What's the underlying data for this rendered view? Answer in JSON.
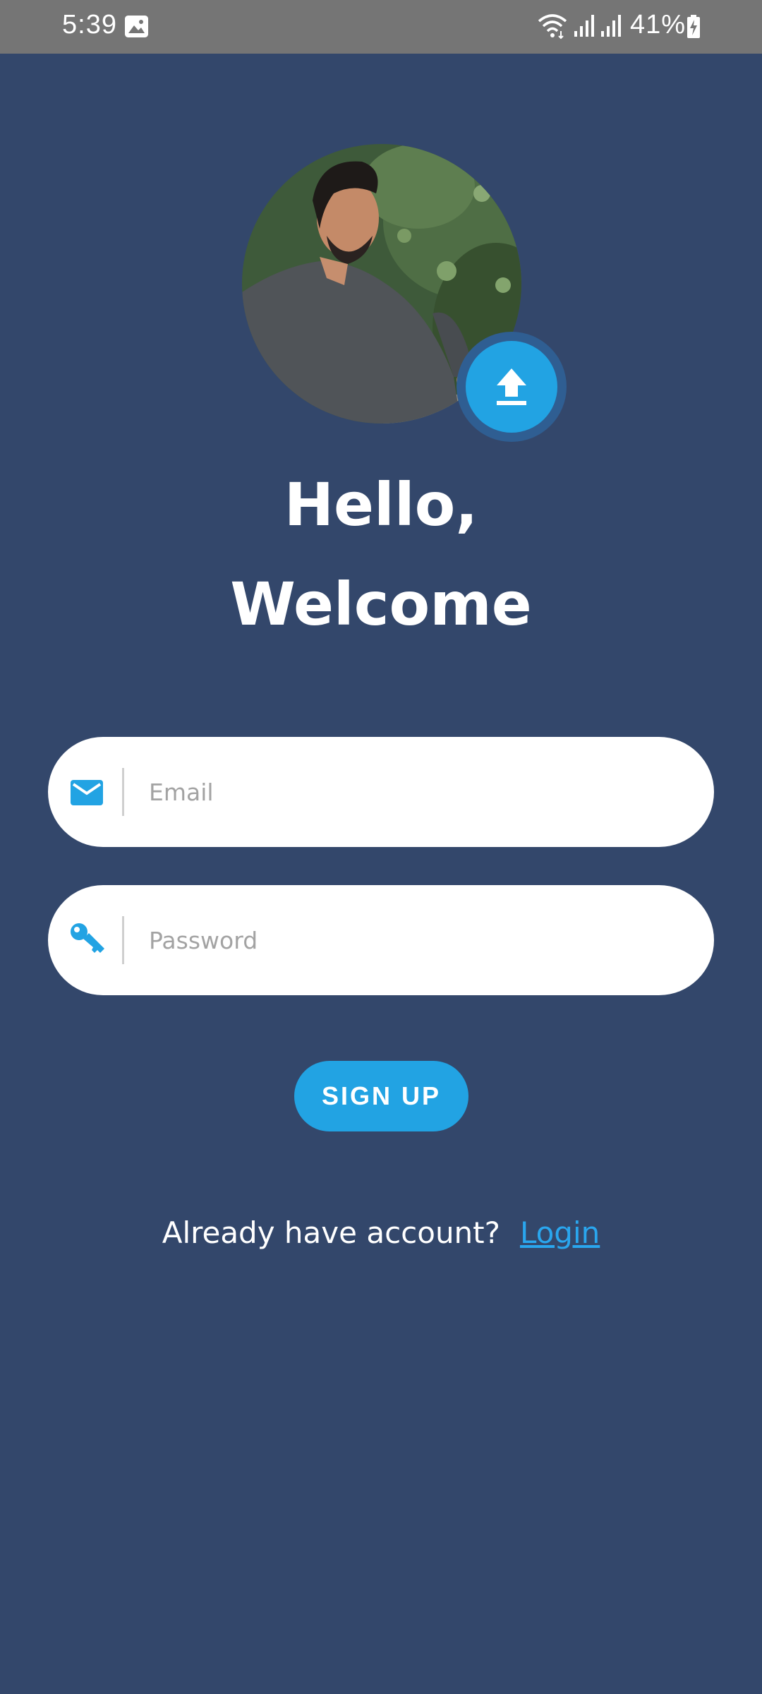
{
  "status_bar": {
    "time": "5:39",
    "battery": "41%",
    "icons": [
      "gallery-icon",
      "wifi-icon",
      "signal-icon",
      "signal-icon",
      "battery-charging-icon"
    ]
  },
  "profile": {
    "avatar": "profile-photo",
    "upload_icon": "upload-icon"
  },
  "greeting": {
    "line1": "Hello,",
    "line2": "Welcome"
  },
  "form": {
    "email": {
      "placeholder": "Email",
      "value": "",
      "icon": "mail-icon"
    },
    "password": {
      "placeholder": "Password",
      "value": "",
      "icon": "key-icon"
    },
    "submit_label": "SIGN UP"
  },
  "footer": {
    "prompt": "Already have account?",
    "login_link": "Login"
  },
  "colors": {
    "background": "#33476B",
    "accent": "#22A3E3",
    "link": "#2AA6EE",
    "status_bar": "#757575"
  }
}
